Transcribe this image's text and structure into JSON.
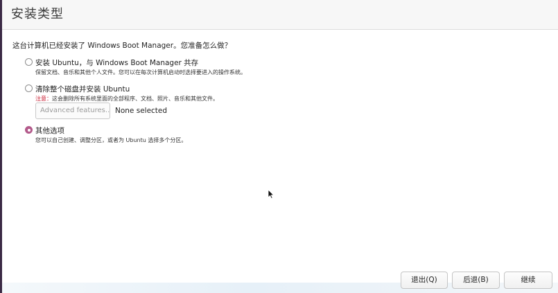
{
  "header": {
    "title": "安装类型"
  },
  "question": "这台计算机已经安装了 Windows Boot Manager。您准备怎么做？",
  "options": [
    {
      "label": "安装 Ubuntu，与 Windows Boot Manager 共存",
      "description": "保留文档、音乐和其他个人文件。您可以在每次计算机启动时选择要进入的操作系统。",
      "selected": false
    },
    {
      "label": "清除整个磁盘并安装 Ubuntu",
      "warning_prefix": "注意：",
      "description": "这会删除所有系统里面的全部程序、文档、照片、音乐和其他文件。",
      "selected": false
    },
    {
      "label": "其他选项",
      "description": "您可以自己创建、调整分区，或者为 Ubuntu 选择多个分区。",
      "selected": true
    }
  ],
  "advanced": {
    "button_label": "Advanced features...",
    "status": "None selected"
  },
  "buttons": {
    "quit": "退出(Q)",
    "back": "后退(B)",
    "continue": "继续"
  },
  "colors": {
    "accent": "#b35a8b",
    "warning": "#c7162b",
    "header_bg": "#f7f7f7"
  }
}
